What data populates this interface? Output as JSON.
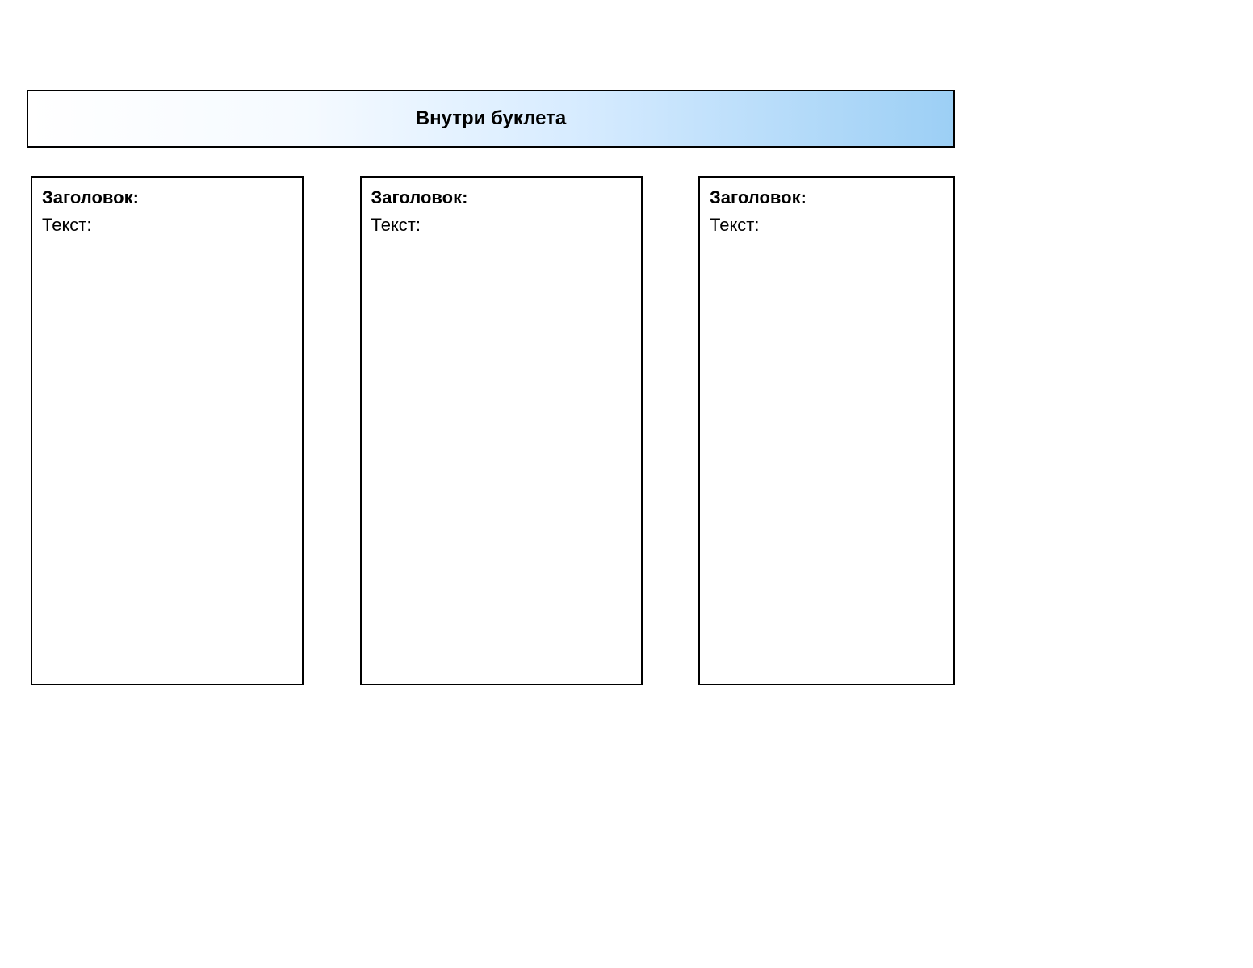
{
  "header": {
    "title": "Внутри буклета"
  },
  "panels": [
    {
      "heading_label": "Заголовок:",
      "text_label": "Текст:"
    },
    {
      "heading_label": "Заголовок:",
      "text_label": "Текст:"
    },
    {
      "heading_label": "Заголовок:",
      "text_label": "Текст:"
    }
  ]
}
